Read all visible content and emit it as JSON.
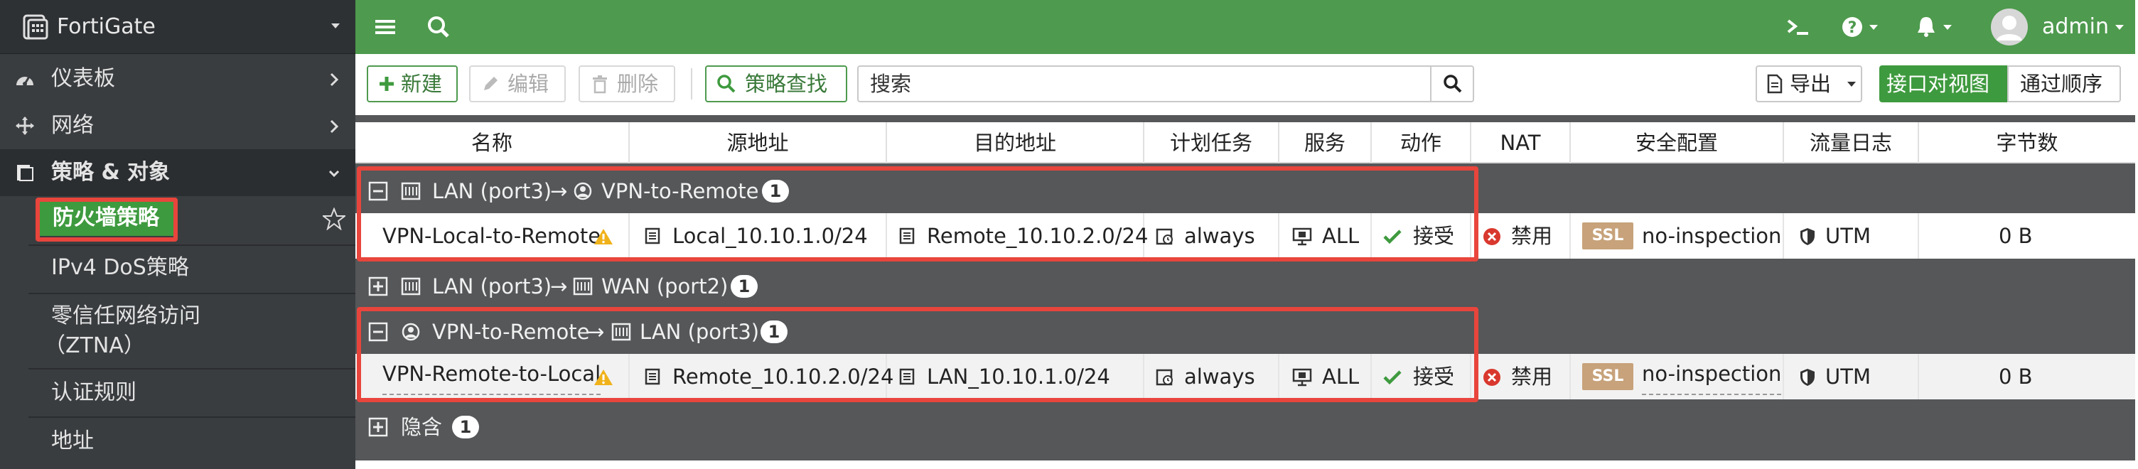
{
  "brand": {
    "name": "FortiGate"
  },
  "sidebar": {
    "items": [
      {
        "label": "仪表板",
        "icon": "dashboard-icon"
      },
      {
        "label": "网络",
        "icon": "network-icon"
      },
      {
        "label": "策略 & 对象",
        "icon": "policy-icon"
      }
    ],
    "subitems": [
      {
        "label": "防火墙策略"
      },
      {
        "label": "IPv4 DoS策略"
      },
      {
        "label": "零信任网络访问"
      },
      {
        "label": "（ZTNA）"
      },
      {
        "label": "认证规则"
      },
      {
        "label": "地址"
      }
    ]
  },
  "topbar": {
    "user": "admin"
  },
  "toolbar": {
    "new_label": "新建",
    "edit_label": "编辑",
    "delete_label": "删除",
    "lookup_label": "策略查找",
    "search_placeholder": "搜索",
    "export_label": "导出",
    "view_interface": "接口对视图",
    "view_sequence": "通过顺序"
  },
  "table": {
    "columns": [
      "名称",
      "源地址",
      "目的地址",
      "计划任务",
      "服务",
      "动作",
      "NAT",
      "安全配置",
      "流量日志",
      "字节数"
    ],
    "groups": [
      {
        "src": "LAN (port3)",
        "arrow": "→",
        "dst": "VPN-to-Remote",
        "count": "1",
        "expanded": true
      },
      {
        "src": "LAN (port3)",
        "arrow": "→",
        "dst": "WAN (port2)",
        "count": "1",
        "expanded": false
      },
      {
        "src": "VPN-to-Remote",
        "arrow": "→",
        "dst": "LAN (port3)",
        "count": "1",
        "expanded": true
      },
      {
        "label": "隐含",
        "count": "1",
        "expanded": false
      }
    ],
    "rows": [
      {
        "name": "VPN-Local-to-Remote",
        "src": "Local_10.10.1.0/24",
        "dst": "Remote_10.10.2.0/24",
        "schedule": "always",
        "service": "ALL",
        "action": "接受",
        "nat": "禁用",
        "ssl": "SSL",
        "profile": "no-inspection",
        "log": "UTM",
        "bytes": "0 B"
      },
      {
        "name": "VPN-Remote-to-Local",
        "src": "Remote_10.10.2.0/24",
        "dst": "LAN_10.10.1.0/24",
        "schedule": "always",
        "service": "ALL",
        "action": "接受",
        "nat": "禁用",
        "ssl": "SSL",
        "profile": "no-inspection",
        "log": "UTM",
        "bytes": "0 B"
      }
    ]
  },
  "colors": {
    "accent": "#3e9a3e",
    "topbar": "#4e9a4e",
    "highlight": "#e8453c"
  }
}
